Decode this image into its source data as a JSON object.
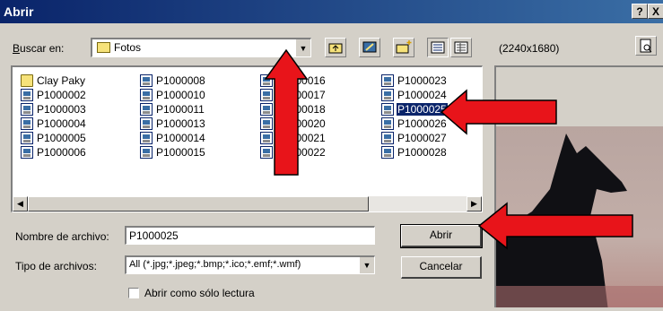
{
  "window": {
    "title": "Abrir",
    "help_label": "?",
    "close_label": "X"
  },
  "toolbar": {
    "look_in_label": "Buscar en:",
    "look_in_value": "Fotos",
    "preview_size": "(2240x1680)"
  },
  "files": [
    {
      "name": "Clay Paky",
      "type": "folder"
    },
    {
      "name": "P1000002",
      "type": "image"
    },
    {
      "name": "P1000003",
      "type": "image"
    },
    {
      "name": "P1000004",
      "type": "image"
    },
    {
      "name": "P1000005",
      "type": "image"
    },
    {
      "name": "P1000006",
      "type": "image"
    },
    {
      "name": "P1000008",
      "type": "image"
    },
    {
      "name": "P1000010",
      "type": "image"
    },
    {
      "name": "P1000011",
      "type": "image"
    },
    {
      "name": "P1000013",
      "type": "image"
    },
    {
      "name": "P1000014",
      "type": "image"
    },
    {
      "name": "P1000015",
      "type": "image"
    },
    {
      "name": "P1000016",
      "type": "image"
    },
    {
      "name": "P1000017",
      "type": "image"
    },
    {
      "name": "P1000018",
      "type": "image"
    },
    {
      "name": "P1000020",
      "type": "image"
    },
    {
      "name": "P1000021",
      "type": "image"
    },
    {
      "name": "P1000022",
      "type": "image"
    },
    {
      "name": "P1000023",
      "type": "image"
    },
    {
      "name": "P1000024",
      "type": "image"
    },
    {
      "name": "P1000025",
      "type": "image",
      "selected": true
    },
    {
      "name": "P1000026",
      "type": "image"
    },
    {
      "name": "P1000027",
      "type": "image"
    },
    {
      "name": "P1000028",
      "type": "image"
    }
  ],
  "form": {
    "filename_label": "Nombre de archivo:",
    "filename_value": "P1000025",
    "filetype_label": "Tipo de archivos:",
    "filetype_value": "All (*.jpg;*.jpeg;*.bmp;*.ico;*.emf;*.wmf)",
    "readonly_label": "Abrir como sólo lectura",
    "readonly_checked": false
  },
  "buttons": {
    "open": "Abrir",
    "cancel": "Cancelar"
  },
  "colors": {
    "titlebar": "#0a246a",
    "selection": "#0a246a",
    "annotation_arrow": "#e8141a",
    "dialog_bg": "#d4d0c8"
  }
}
